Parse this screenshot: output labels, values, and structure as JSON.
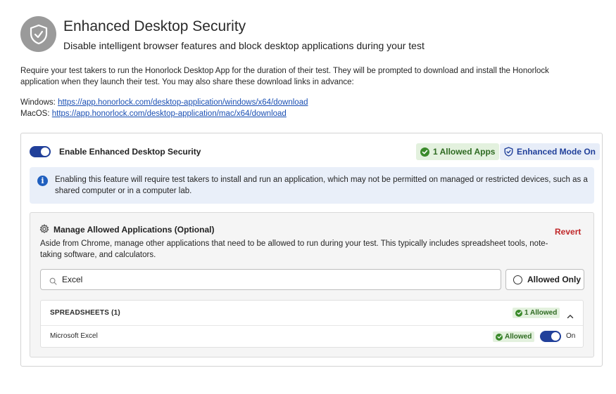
{
  "header": {
    "icon": "shield-check-icon",
    "title": "Enhanced Desktop Security",
    "subtitle": "Disable intelligent browser features and block desktop applications during your test"
  },
  "description": "Require your test takers to run the Honorlock Desktop App for the duration of their test. They will be prompted to download and install the Honorlock application when they launch their test. You may also share these download links in advance:",
  "links": {
    "windows_label": "Windows:",
    "windows_url": "https://app.honorlock.com/desktop-application/windows/x64/download",
    "mac_label": "MacOS:",
    "mac_url": "https://app.honorlock.com/desktop-application/mac/x64/download"
  },
  "card": {
    "toggle_label": "Enable Enhanced Desktop Security",
    "toggle_on": true,
    "allowed_apps_badge": "1 Allowed Apps",
    "enhanced_badge": "Enhanced Mode On",
    "info_text": "Enabling this feature will require test takers to install and run an application, which may not be permitted on managed or restricted devices, such as a shared computer or in a computer lab."
  },
  "manage": {
    "title": "Manage Allowed Applications (Optional)",
    "revert_label": "Revert",
    "description": "Aside from Chrome, manage other applications that need to be allowed to run during your test. This typically includes spreadsheet tools, note-taking software, and calculators.",
    "search_value": "Excel",
    "allowed_only_label": "Allowed Only",
    "allowed_only_checked": false
  },
  "groups": [
    {
      "label": "SPREADSHEETS (1)",
      "badge": "1 Allowed",
      "expanded": true,
      "apps": [
        {
          "name": "Microsoft Excel",
          "status": "Allowed",
          "toggle_label": "On",
          "enabled": true
        }
      ]
    }
  ],
  "colors": {
    "accent": "#21409a",
    "success": "#3a8a2a",
    "danger": "#c0282a",
    "link": "#1a4fb3"
  }
}
